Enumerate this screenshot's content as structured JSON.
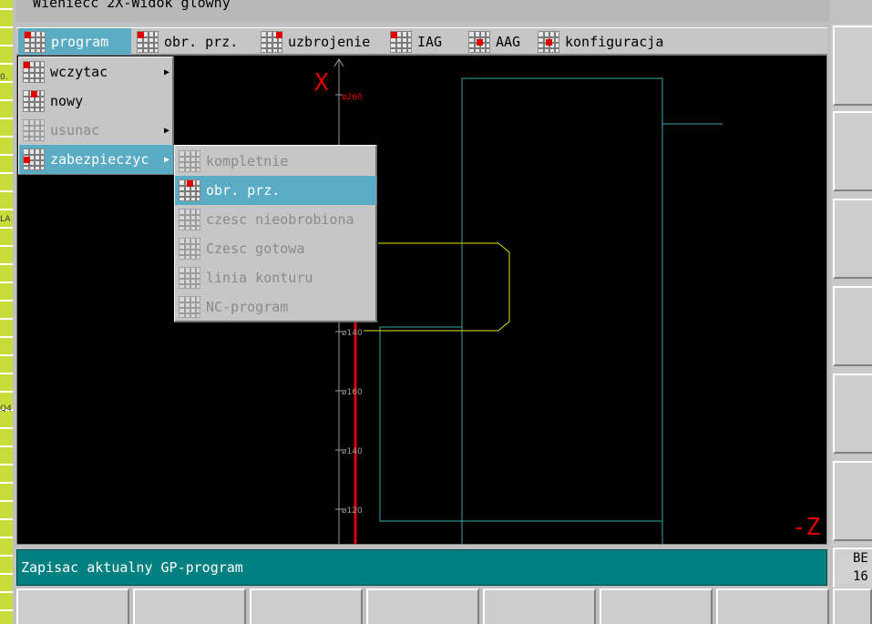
{
  "window": {
    "title": "Wieniecc  2X-Widok glowny"
  },
  "left_strip": {
    "labels": [
      "0.",
      "LA",
      "Q4"
    ]
  },
  "menubar": {
    "items": [
      {
        "label": "program",
        "active": true
      },
      {
        "label": "obr. prz.",
        "active": false
      },
      {
        "label": "uzbrojenie",
        "active": false
      },
      {
        "label": "IAG",
        "active": false
      },
      {
        "label": "AAG",
        "active": false
      },
      {
        "label": "konfiguracja",
        "active": false
      }
    ]
  },
  "program_menu": {
    "items": [
      {
        "label": "wczytac",
        "has_submenu": true,
        "enabled": true
      },
      {
        "label": "nowy",
        "has_submenu": false,
        "enabled": true
      },
      {
        "label": "usunac",
        "has_submenu": true,
        "enabled": false
      },
      {
        "label": "zabezpieczyc",
        "has_submenu": true,
        "enabled": true,
        "active": true
      }
    ]
  },
  "save_submenu": {
    "items": [
      {
        "label": "kompletnie",
        "enabled": false
      },
      {
        "label": "obr. prz.",
        "enabled": true,
        "active": true
      },
      {
        "label": "czesc nieobrobiona",
        "enabled": false
      },
      {
        "label": "Czesc gotowa",
        "enabled": false
      },
      {
        "label": "linia konturu",
        "enabled": false
      },
      {
        "label": "NC-program",
        "enabled": false
      }
    ]
  },
  "viewport": {
    "x_axis_label": "X",
    "z_axis_label": "-Z",
    "diameter_ticks": [
      "ø260",
      "ø140",
      "ø160",
      "ø140",
      "ø120"
    ]
  },
  "status": {
    "message": "Zapisac aktualny GP-program"
  },
  "mode": {
    "line1": "BE",
    "line2": "16"
  },
  "colors": {
    "menu_highlight": "#5aabc4",
    "status_bg": "#008080",
    "viewport_bg": "#000000",
    "axis_red": "#e00000",
    "contour_cyan": "#3aa6a6",
    "contour_yellow": "#e6e600"
  }
}
